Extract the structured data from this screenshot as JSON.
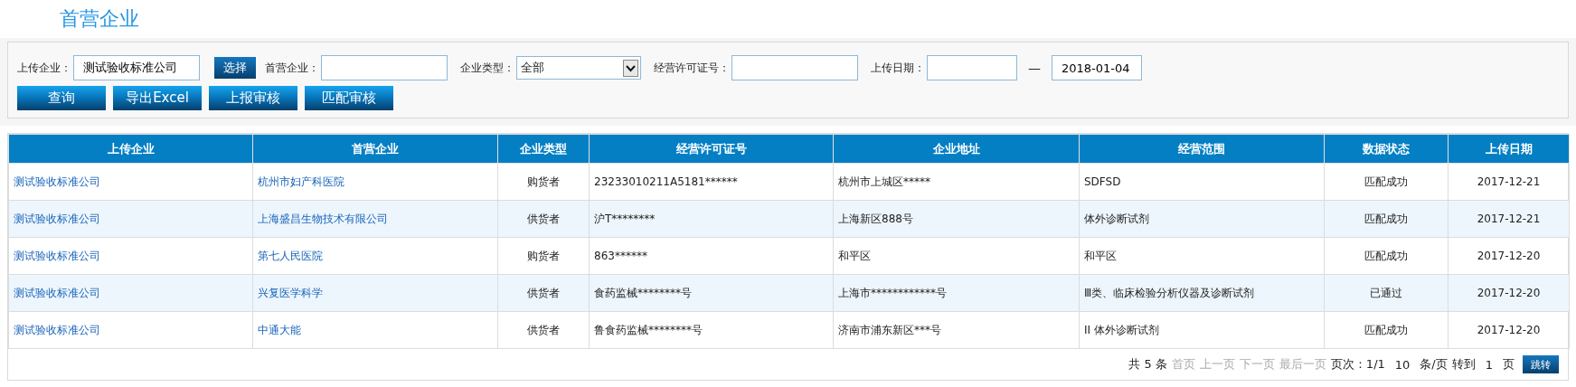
{
  "page_title": "首营企业",
  "filters": {
    "fields": [
      {
        "kind": "text",
        "label": "上传企业：",
        "value": "测试验收标准公司",
        "button": "选择"
      },
      {
        "kind": "text",
        "label": "首营企业："
      },
      {
        "kind": "select",
        "label": "企业类型：",
        "value": "全部"
      },
      {
        "kind": "text",
        "label": "经营许可证号："
      },
      {
        "kind": "range",
        "label": "上传日期：",
        "separator": "—",
        "to": "2018-01-04"
      }
    ],
    "buttons": [
      "查询",
      "导出Excel",
      "上报审核",
      "匹配审核"
    ]
  },
  "table": {
    "columns": [
      "上传企业",
      "首营企业",
      "企业类型",
      "经营许可证号",
      "企业地址",
      "经营范围",
      "数据状态",
      "上传日期"
    ],
    "rows": [
      [
        "测试验收标准公司",
        "杭州市妇产科医院",
        "购货者",
        "23233010211A5181******",
        "杭州市上城区*****",
        "SDFSD",
        "匹配成功",
        "2017-12-21"
      ],
      [
        "测试验收标准公司",
        "上海盛昌生物技术有限公司",
        "供货者",
        "沪T********",
        "上海新区888号",
        "体外诊断试剂",
        "匹配成功",
        "2017-12-21"
      ],
      [
        "测试验收标准公司",
        "第七人民医院",
        "购货者",
        "863******",
        "和平区",
        "和平区",
        "匹配成功",
        "2017-12-20"
      ],
      [
        "测试验收标准公司",
        "兴复医学科学",
        "供货者",
        "食药监械********号",
        "上海市************号",
        "Ⅲ类、临床检验分析仪器及诊断试剂",
        "已通过",
        "2017-12-20"
      ],
      [
        "测试验收标准公司",
        "中通大能",
        "供货者",
        "鲁食药监械********号",
        "济南市浦东新区***号",
        "II 体外诊断试剂",
        "匹配成功",
        "2017-12-20"
      ]
    ]
  },
  "pagination": {
    "total": "共 5 条",
    "links": [
      {
        "label": "首页",
        "disabled": true
      },
      {
        "label": "上一页",
        "disabled": true
      },
      {
        "label": "下一页",
        "disabled": true
      },
      {
        "label": "最后一页",
        "disabled": true
      }
    ],
    "page_info": "页次：1/1",
    "page_size": "10",
    "per_page_label": "条/页",
    "goto_label": "转到",
    "goto_value": "1",
    "page_label": "页",
    "go_button": "跳转"
  }
}
